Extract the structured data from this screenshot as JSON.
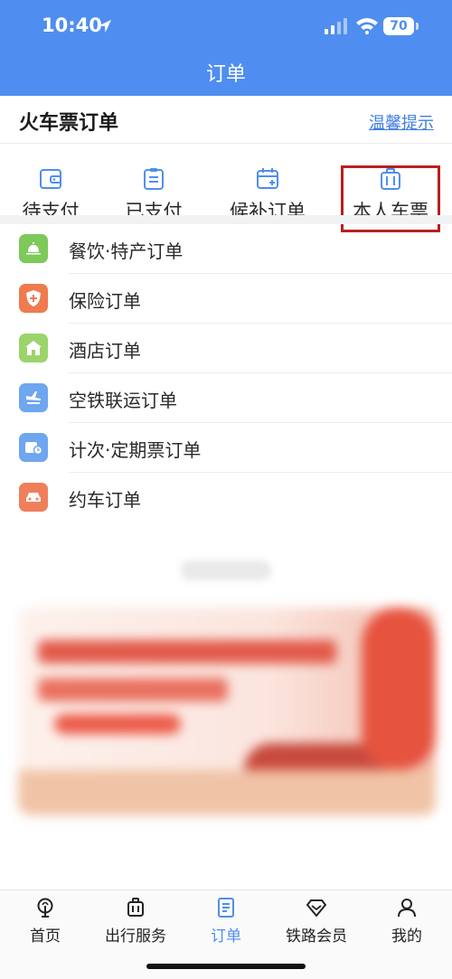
{
  "status_bar": {
    "time": "10:40",
    "battery": "70"
  },
  "header": {
    "title": "订单"
  },
  "train": {
    "title": "火车票订单",
    "tips_link": "温馨提示",
    "tabs": [
      {
        "label": "待支付",
        "icon": "wallet-icon"
      },
      {
        "label": "已支付",
        "icon": "clipboard-icon"
      },
      {
        "label": "候补订单",
        "icon": "calendar-add-icon"
      },
      {
        "label": "本人车票",
        "icon": "luggage-icon"
      }
    ]
  },
  "orders": [
    {
      "label": "餐饮·特产订单",
      "icon": "dining-bell-icon",
      "color": "#7dc95a"
    },
    {
      "label": "保险订单",
      "icon": "shield-plus-icon",
      "color": "#ef7b4f"
    },
    {
      "label": "酒店订单",
      "icon": "hotel-icon",
      "color": "#9ad46b"
    },
    {
      "label": "空铁联运订单",
      "icon": "plane-train-icon",
      "color": "#6ea6ef"
    },
    {
      "label": "计次·定期票订单",
      "icon": "ticket-clock-icon",
      "color": "#6ea6ef"
    },
    {
      "label": "约车订单",
      "icon": "car-icon",
      "color": "#ef7f5b"
    }
  ],
  "nav": {
    "items": [
      {
        "label": "首页",
        "icon": "railway-home-icon"
      },
      {
        "label": "出行服务",
        "icon": "luggage-icon"
      },
      {
        "label": "订单",
        "icon": "order-doc-icon"
      },
      {
        "label": "铁路会员",
        "icon": "diamond-icon"
      },
      {
        "label": "我的",
        "icon": "person-icon"
      }
    ],
    "active_index": 2
  },
  "colors": {
    "primary": "#4f8ef0",
    "highlight_box": "#b7201d"
  }
}
